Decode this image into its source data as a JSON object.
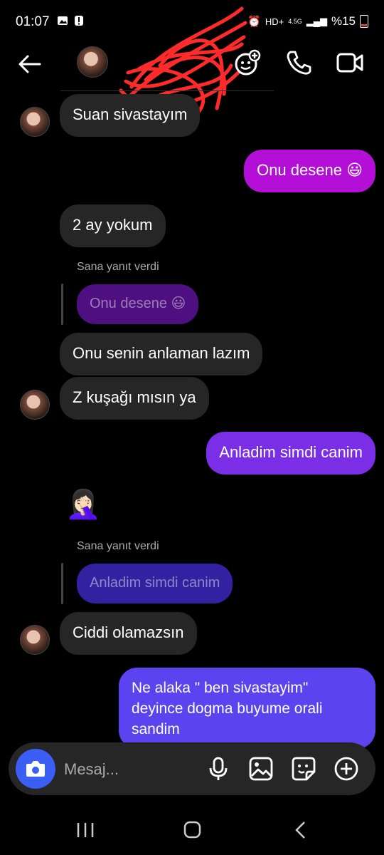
{
  "status_bar": {
    "time": "01:07",
    "network_label": "4.5G",
    "battery": "%15"
  },
  "header": {
    "back_icon": "arrow-left-icon",
    "actions": [
      "add-people-icon",
      "phone-icon",
      "video-icon"
    ]
  },
  "messages": [
    {
      "side": "in",
      "text": "Suan sivastayım"
    },
    {
      "side": "out",
      "text": "Onu desene 😃"
    },
    {
      "side": "in",
      "text": "2 ay yokum"
    },
    {
      "reply_label": "Sana yanıt verdi",
      "quoted": "Onu desene 😃"
    },
    {
      "side": "in",
      "text": "Onu senin anlaman lazım"
    },
    {
      "side": "in",
      "text": "Z kuşağı mısın ya"
    },
    {
      "side": "out",
      "text": "Anladim simdi canim"
    },
    {
      "side": "in",
      "text": "🤦🏻‍♀️"
    },
    {
      "reply_label": "Sana yanıt verdi",
      "quoted": "Anladim simdi canim"
    },
    {
      "side": "in",
      "text": "Ciddi olamazsın"
    },
    {
      "side": "out",
      "text": "Ne alaka \" ben sivastayim\"\ndeyince dogma buyume orali\nsandim"
    }
  ],
  "composer": {
    "placeholder": "Mesaj..."
  },
  "colors": {
    "bubble_in": "#262626",
    "bubble_out_magenta": "#b30fd6",
    "bubble_out_purple": "#7a2ee6",
    "bubble_out_blue": "#5b44f0",
    "camera_button": "#3b5ef5"
  }
}
